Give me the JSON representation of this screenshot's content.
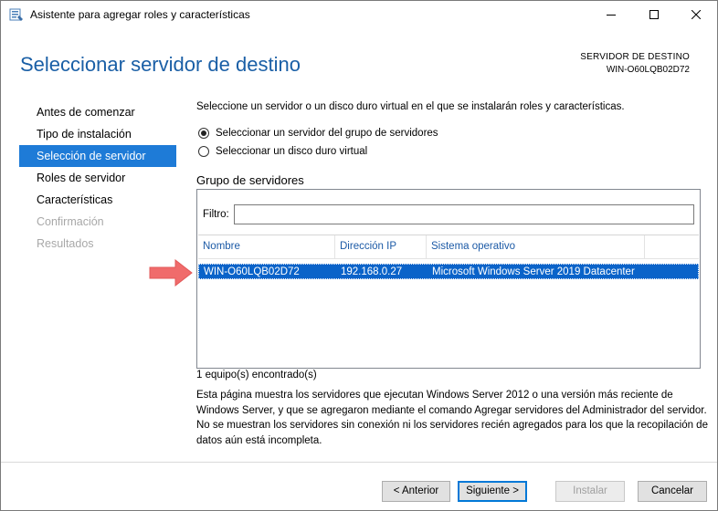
{
  "window": {
    "title": "Asistente para agregar roles y características"
  },
  "header": {
    "title": "Seleccionar servidor de destino",
    "dest_label": "SERVIDOR DE DESTINO",
    "dest_value": "WIN-O60LQB02D72"
  },
  "nav": {
    "items": [
      {
        "label": "Antes de comenzar",
        "state": "normal"
      },
      {
        "label": "Tipo de instalación",
        "state": "normal"
      },
      {
        "label": "Selección de servidor",
        "state": "active"
      },
      {
        "label": "Roles de servidor",
        "state": "normal"
      },
      {
        "label": "Características",
        "state": "normal"
      },
      {
        "label": "Confirmación",
        "state": "disabled"
      },
      {
        "label": "Resultados",
        "state": "disabled"
      }
    ]
  },
  "main": {
    "intro": "Seleccione un servidor o un disco duro virtual en el que se instalarán roles y características.",
    "radio_pool": "Seleccionar un servidor del grupo de servidores",
    "radio_vhd": "Seleccionar un disco duro virtual",
    "selected_option": "pool",
    "group_title": "Grupo de servidores",
    "filter_label": "Filtro:",
    "filter_value": "",
    "columns": [
      "Nombre",
      "Dirección IP",
      "Sistema operativo",
      ""
    ],
    "rows": [
      {
        "name": "WIN-O60LQB02D72",
        "ip": "192.168.0.27",
        "os": "Microsoft Windows Server 2019 Datacenter",
        "selected": true
      }
    ],
    "count_text": "1 equipo(s) encontrado(s)",
    "description": "Esta página muestra los servidores que ejecutan Windows Server 2012 o una versión más reciente de Windows Server, y que se agregaron mediante el comando Agregar servidores del Administrador del servidor. No se muestran los servidores sin conexión ni los servidores recién agregados para los que la recopilación de datos aún está incompleta."
  },
  "buttons": {
    "prev": "< Anterior",
    "next": "Siguiente >",
    "install": "Instalar",
    "cancel": "Cancelar"
  },
  "colors": {
    "title_blue": "#1a5fa6",
    "nav_active": "#1e7bd7",
    "row_selected": "#0a63c9",
    "annotation_arrow": "#f06b6b"
  },
  "icons": {
    "app": "wizard-app-icon",
    "minimize": "minimize-icon",
    "maximize": "maximize-icon",
    "close": "close-icon",
    "annotation": "red-arrow-icon"
  }
}
